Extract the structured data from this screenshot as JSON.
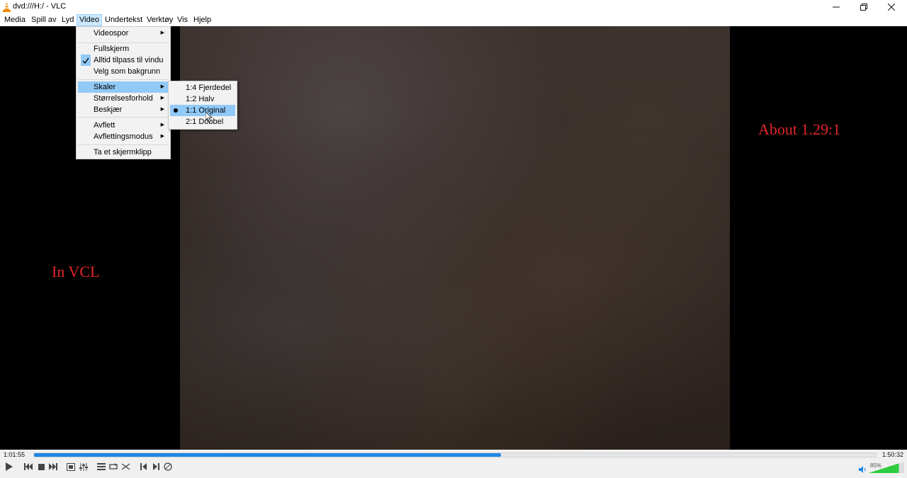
{
  "window": {
    "title": "dvd:///H:/ - VLC"
  },
  "menubar": {
    "items": [
      {
        "label": "Media"
      },
      {
        "label": "Spill av"
      },
      {
        "label": "Lyd"
      },
      {
        "label": "Video"
      },
      {
        "label": "Undertekst"
      },
      {
        "label": "Verktøy"
      },
      {
        "label": "Vis"
      },
      {
        "label": "Hjelp"
      }
    ]
  },
  "video_menu": {
    "items": [
      {
        "label": "Videospor"
      },
      {
        "label": "Fullskjerm"
      },
      {
        "label": "Alltid tilpass til vindu"
      },
      {
        "label": "Velg som bakgrunn"
      },
      {
        "label": "Skaler"
      },
      {
        "label": "Størrelsesforhold"
      },
      {
        "label": "Beskjær"
      },
      {
        "label": "Avflett"
      },
      {
        "label": "Avflettingsmodus"
      },
      {
        "label": "Ta et skjermklipp"
      }
    ]
  },
  "scale_submenu": {
    "items": [
      {
        "label": "1:4 Fjerdedel"
      },
      {
        "label": "1:2 Halv"
      },
      {
        "label": "1:1 Original"
      },
      {
        "label": "2:1 Dobbel"
      }
    ]
  },
  "overlays": {
    "left": "In VCL",
    "right": "About 1.29:1"
  },
  "controls": {
    "elapsed": "1:01:55",
    "total": "1:50:32",
    "progress": 0.555,
    "volume": "85%",
    "volume_level": 0.85
  },
  "colors": {
    "accent": "#1e88e5",
    "menu_highlight": "#91c9f7",
    "overlay_text": "#e3262c"
  }
}
